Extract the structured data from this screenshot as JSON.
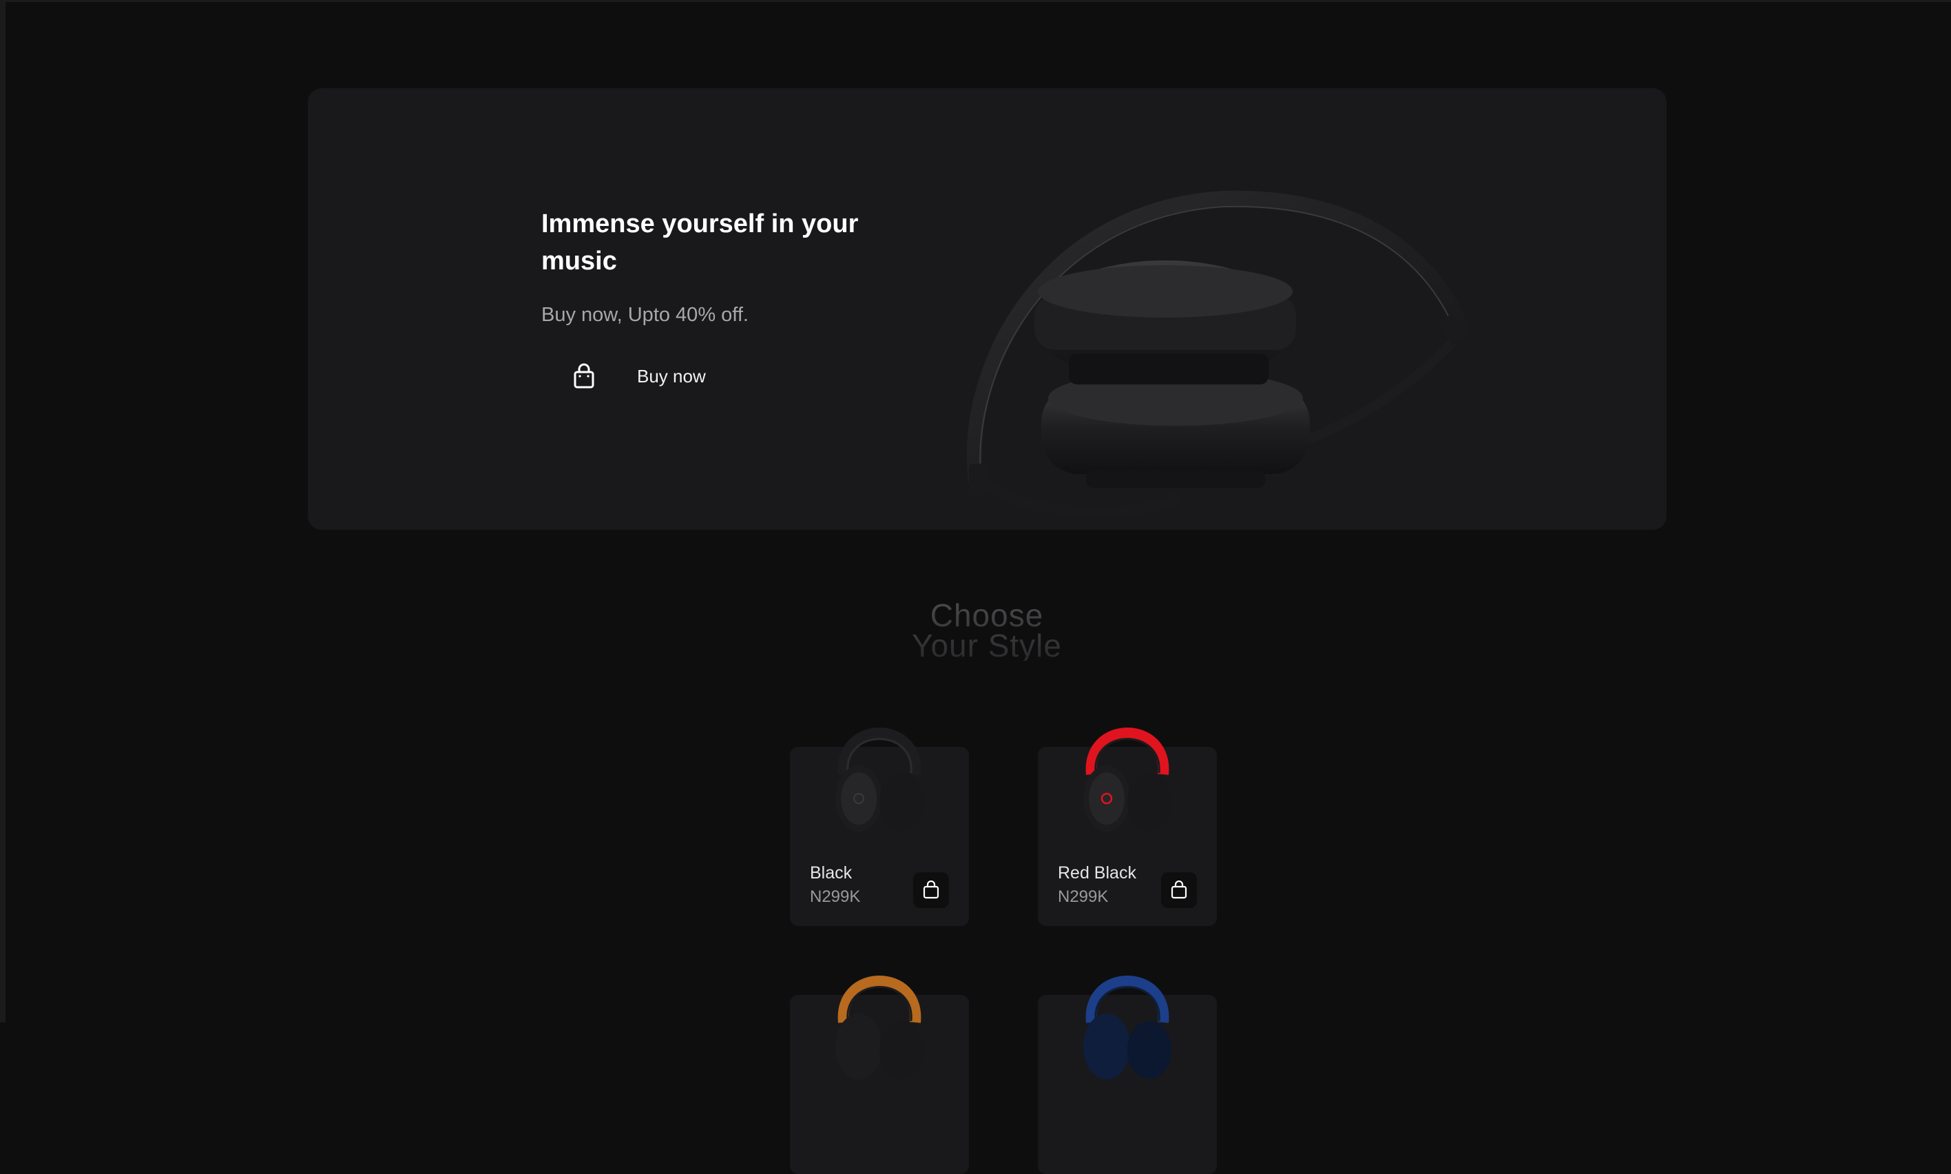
{
  "hero": {
    "title": "Immense yourself in your music",
    "subtitle": "Buy now, Upto 40% off.",
    "buy_label": "Buy now",
    "buy_icon": "shopping-bag-icon"
  },
  "section": {
    "title_line1": "Choose",
    "title_line2": "Your Style"
  },
  "products": [
    {
      "name": "Black",
      "price": "N299K",
      "color": "#1c1c1e",
      "accent": "#2a2a2c",
      "cart_icon": "shopping-bag-icon"
    },
    {
      "name": "Red Black",
      "price": "N299K",
      "color": "#1c1c1e",
      "accent": "#e0141e",
      "cart_icon": "shopping-bag-icon"
    },
    {
      "name": "",
      "price": "",
      "color": "#1c1c1e",
      "accent": "#b86a1e",
      "cart_icon": "shopping-bag-icon"
    },
    {
      "name": "",
      "price": "",
      "color": "#0f1e3c",
      "accent": "#1d3f8a",
      "cart_icon": "shopping-bag-icon"
    }
  ],
  "colors": {
    "background": "#0e0e0f",
    "card": "#19191b",
    "text_primary": "#ffffff",
    "text_secondary": "#a8a8aa"
  }
}
